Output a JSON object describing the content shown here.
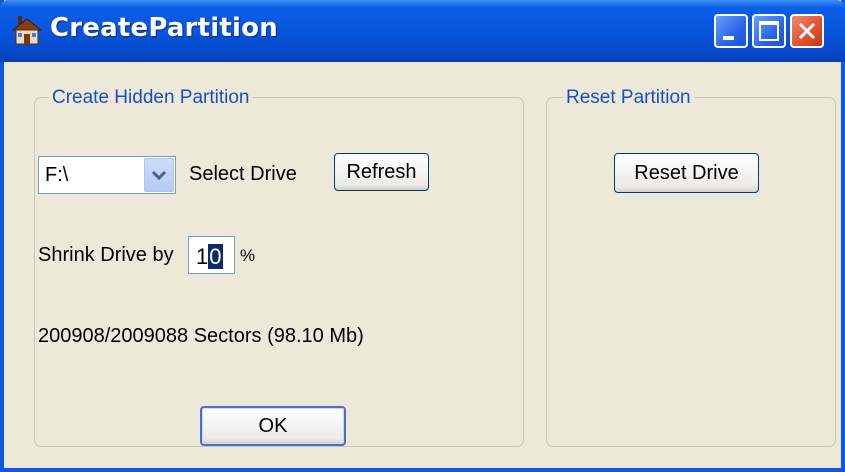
{
  "window": {
    "title": "CreatePartition"
  },
  "create_group": {
    "legend": "Create Hidden Partition",
    "drive_select": {
      "value": "F:\\"
    },
    "select_drive_label": "Select Drive",
    "refresh_label": "Refresh",
    "shrink_label": "Shrink Drive by",
    "shrink_value_normal": "1",
    "shrink_value_selected": "0",
    "percent_label": "%",
    "sectors_info": "200908/2009088 Sectors (98.10 Mb)",
    "ok_label": "OK"
  },
  "reset_group": {
    "legend": "Reset Partition",
    "reset_label": "Reset Drive"
  },
  "icons": [
    "app-house-icon",
    "minimize-icon",
    "maximize-icon",
    "close-icon",
    "chevron-down-icon"
  ],
  "colors": {
    "titlebar": "#0a58e0",
    "face": "#ece9d8",
    "legend_text": "#1c4ecb",
    "close": "#e0502c"
  }
}
